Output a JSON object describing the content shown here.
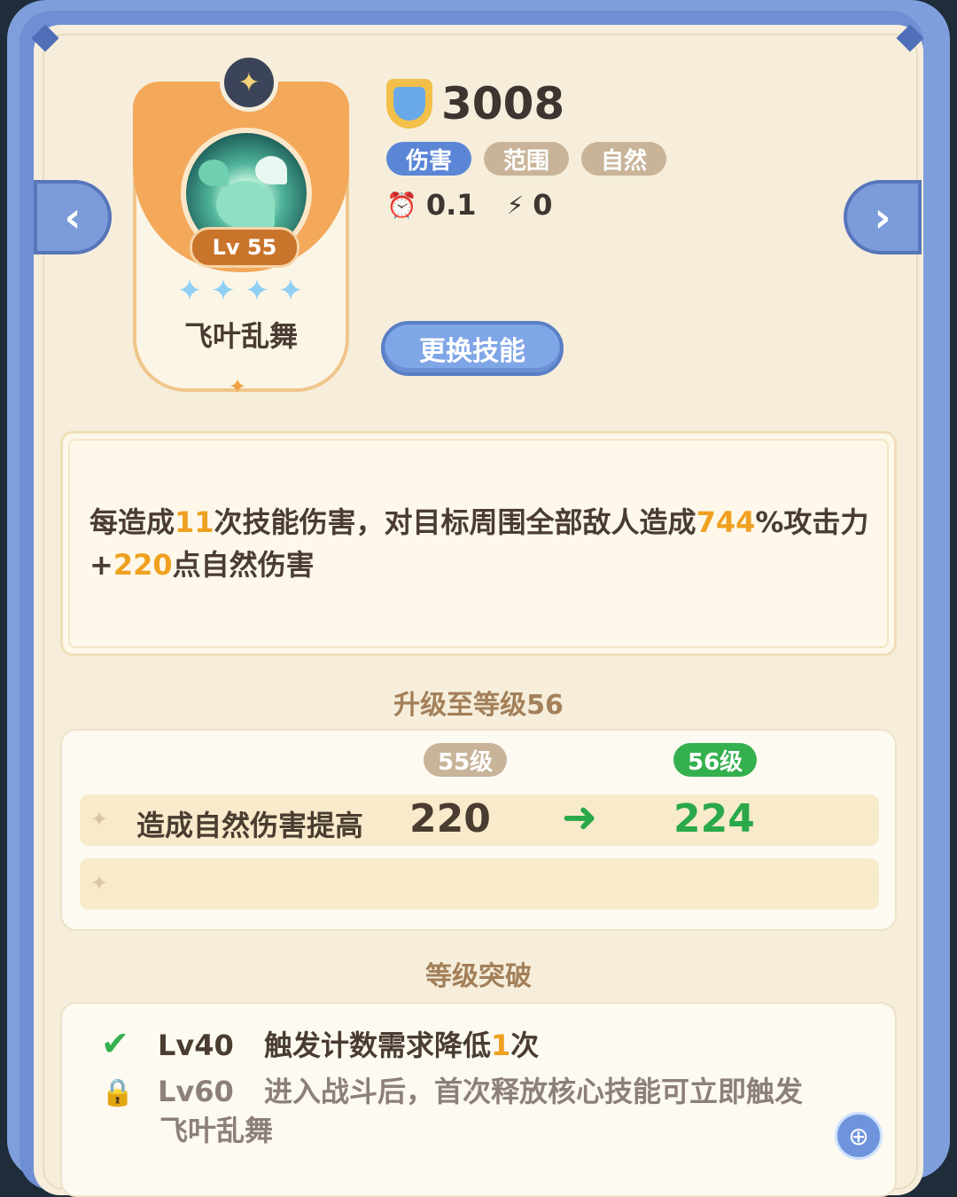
{
  "skill": {
    "name": "飞叶乱舞",
    "level_label": "Lv 55",
    "stars": 4,
    "power": "3008",
    "tags": [
      {
        "label": "伤害",
        "color": "#5b86d6"
      },
      {
        "label": "范围",
        "color": "#c9b49a"
      },
      {
        "label": "自然",
        "color": "#c9b49a"
      }
    ],
    "cooldown": "0.1",
    "energy": "0"
  },
  "buttons": {
    "change_skill": "更换技能",
    "prev": "‹",
    "next": "›"
  },
  "description": {
    "parts": [
      {
        "text": "每造成",
        "hl": false
      },
      {
        "text": "11",
        "hl": true
      },
      {
        "text": "次技能伤害，对目标周围全部敌人造成",
        "hl": false
      },
      {
        "text": "744",
        "hl": true
      },
      {
        "text": "%攻击力+",
        "hl": false
      },
      {
        "text": "220",
        "hl": true
      },
      {
        "text": "点自然伤害",
        "hl": false
      }
    ]
  },
  "upgrade": {
    "title": "升级至等级56",
    "current_level": "55级",
    "next_level": "56级",
    "stat_label": "造成自然伤害提高",
    "old_value": "220",
    "new_value": "224",
    "colors": {
      "current": "#c9b49a",
      "next": "#35b04f"
    }
  },
  "breakthrough": {
    "title": "等级突破",
    "items": [
      {
        "status": "unlocked",
        "level": "Lv40",
        "text_before": "触发计数需求降低",
        "highlight": "1",
        "text_after": "次"
      },
      {
        "status": "locked",
        "level": "Lv60",
        "text_before": "进入战斗后，首次释放核心技能可立即触发",
        "highlight": "",
        "text_after": "",
        "text_line2": "飞叶乱舞"
      }
    ]
  }
}
